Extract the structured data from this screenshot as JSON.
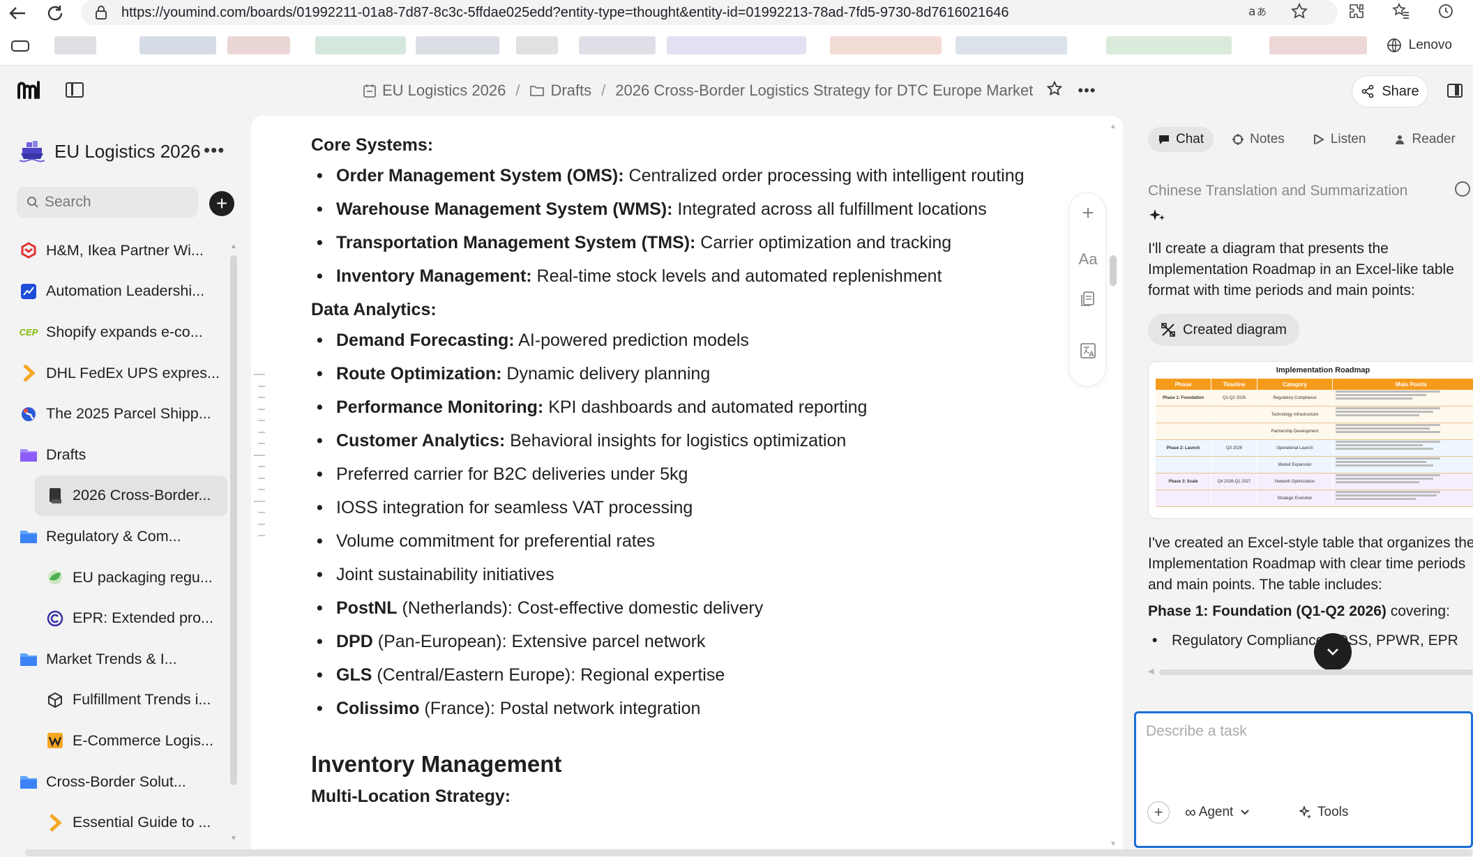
{
  "browser": {
    "url": "https://youmind.com/boards/01992211-01a8-7d87-8c3c-5ffdae025edd?entity-type=thought&entity-id=01992213-78ad-7fd5-9730-8d7616021646",
    "profile": "Lenovo",
    "icons": [
      "back-arrow-icon",
      "reload-icon",
      "lock-icon",
      "translate-icon",
      "star-icon",
      "extensions-icon",
      "favorites-icon",
      "history-icon"
    ]
  },
  "header": {
    "breadcrumb": [
      "EU Logistics 2026",
      "Drafts",
      "2026 Cross-Border Logistics Strategy for DTC Europe Market"
    ],
    "share_label": "Share"
  },
  "sidebar": {
    "board_title": "EU Logistics 2026",
    "search_placeholder": "Search",
    "items": [
      {
        "label": "H&M, Ikea Partner Wi...",
        "icon": "hm-logo-icon",
        "color": "#e2322f",
        "indent": false
      },
      {
        "label": "Automation Leadershi...",
        "icon": "automation-logo-icon",
        "color": "#1d4ed8",
        "indent": false
      },
      {
        "label": "Shopify expands e-co...",
        "icon": "cep-logo-icon",
        "color": "#7fb800",
        "indent": false
      },
      {
        "label": "DHL FedEx UPS expres...",
        "icon": "chevron-logo-icon",
        "color": "#f5a623",
        "indent": false
      },
      {
        "label": "The 2025 Parcel Shipp...",
        "icon": "globe-logo-icon",
        "color": "#2a5bd7",
        "indent": false
      },
      {
        "label": "Drafts",
        "icon": "folder-icon",
        "color": "#8b5cf6",
        "indent": false
      },
      {
        "label": "2026 Cross-Border...",
        "icon": "document-icon",
        "color": "#333333",
        "indent": true,
        "active": true
      },
      {
        "label": "Regulatory & Com...",
        "icon": "folder-icon",
        "color": "#3b82f6",
        "indent": false
      },
      {
        "label": "EU packaging regu...",
        "icon": "leaf-logo-icon",
        "color": "#4caf50",
        "indent": true
      },
      {
        "label": "EPR: Extended pro...",
        "icon": "copyright-logo-icon",
        "color": "#3730a3",
        "indent": true
      },
      {
        "label": "Market Trends & I...",
        "icon": "folder-icon",
        "color": "#3b82f6",
        "indent": false
      },
      {
        "label": "Fulfillment Trends i...",
        "icon": "box-logo-icon",
        "color": "#333333",
        "indent": true
      },
      {
        "label": "E-Commerce Logis...",
        "icon": "w-logo-icon",
        "color": "#f5a623",
        "indent": true
      },
      {
        "label": "Cross-Border Solut...",
        "icon": "folder-icon",
        "color": "#3b82f6",
        "indent": false
      },
      {
        "label": "Essential Guide to ...",
        "icon": "chevron-logo-icon",
        "color": "#f5a623",
        "indent": true
      }
    ]
  },
  "doc": {
    "core_systems_heading": "Core Systems:",
    "core_systems": [
      {
        "bold": "Order Management System (OMS):",
        "text": " Centralized order processing with intelligent routing"
      },
      {
        "bold": "Warehouse Management System (WMS):",
        "text": " Integrated across all fulfillment locations"
      },
      {
        "bold": "Transportation Management System (TMS):",
        "text": " Carrier optimization and tracking"
      },
      {
        "bold": "Inventory Management:",
        "text": " Real-time stock levels and automated replenishment"
      }
    ],
    "data_analytics_heading": "Data Analytics:",
    "data_analytics": [
      {
        "bold": "Demand Forecasting:",
        "text": " AI-powered prediction models"
      },
      {
        "bold": "Route Optimization:",
        "text": " Dynamic delivery planning"
      },
      {
        "bold": "Performance Monitoring:",
        "text": " KPI dashboards and automated reporting"
      },
      {
        "bold": "Customer Analytics:",
        "text": " Behavioral insights for logistics optimization"
      },
      {
        "bold": "",
        "text": "Preferred carrier for B2C deliveries under 5kg"
      },
      {
        "bold": "",
        "text": "IOSS integration for seamless VAT processing"
      },
      {
        "bold": "",
        "text": "Volume commitment for preferential rates"
      },
      {
        "bold": "",
        "text": "Joint sustainability initiatives"
      },
      {
        "bold": "PostNL",
        "text": " (Netherlands): Cost-effective domestic delivery"
      },
      {
        "bold": "DPD",
        "text": " (Pan-European): Extensive parcel network"
      },
      {
        "bold": "GLS",
        "text": " (Central/Eastern Europe): Regional expertise"
      },
      {
        "bold": "Colissimo",
        "text": " (France): Postal network integration"
      }
    ],
    "inventory_heading": "Inventory Management",
    "multi_location_heading": "Multi-Location Strategy:",
    "float_tools": [
      "plus-icon",
      "font-size-icon",
      "copy-icon",
      "translate-icon"
    ],
    "float_font_label": "Aa"
  },
  "chat": {
    "tabs": [
      {
        "label": "Chat",
        "icon": "chat-icon",
        "active": true
      },
      {
        "label": "Notes",
        "icon": "notes-icon",
        "active": false
      },
      {
        "label": "Listen",
        "icon": "headphones-icon",
        "active": false
      },
      {
        "label": "Reader",
        "icon": "reader-icon",
        "active": false
      }
    ],
    "title": "Chinese Translation and Summarization",
    "message1": [
      "I'll create a diagram that presents the",
      "Implementation Roadmap in an Excel-like table",
      "format with time periods and main points:"
    ],
    "diagram_chip": "Created diagram",
    "diagram": {
      "title": "Implementation Roadmap",
      "headers": [
        "Phase",
        "Timeline",
        "Category",
        "Main Points"
      ],
      "rows": [
        {
          "phase": "Phase 1: Foundation",
          "timeline": "Q1-Q2 2026",
          "category": "Regulatory Compliance"
        },
        {
          "phase": "",
          "timeline": "",
          "category": "Technology Infrastructure"
        },
        {
          "phase": "",
          "timeline": "",
          "category": "Partnership Development"
        },
        {
          "phase": "Phase 2: Launch",
          "timeline": "Q3 2026",
          "category": "Operational Launch"
        },
        {
          "phase": "",
          "timeline": "",
          "category": "Market Expansion"
        },
        {
          "phase": "Phase 3: Scale",
          "timeline": "Q4 2026-Q1 2027",
          "category": "Network Optimization"
        },
        {
          "phase": "",
          "timeline": "",
          "category": "Strategic Evolution"
        }
      ],
      "header_color": "#f59b1c"
    },
    "message2": [
      "I've created an Excel-style table that organizes the",
      "Implementation Roadmap with clear time periods",
      "and main points. The table includes:"
    ],
    "phase1_bold": "Phase 1: Foundation (Q1-Q2 2026)",
    "phase1_rest": " covering:",
    "bullet1": "Regulatory Compliance (IOSS, PPWR, EPR",
    "composer_placeholder": "Describe a task",
    "agent_label": "Agent",
    "tools_label": "Tools"
  }
}
